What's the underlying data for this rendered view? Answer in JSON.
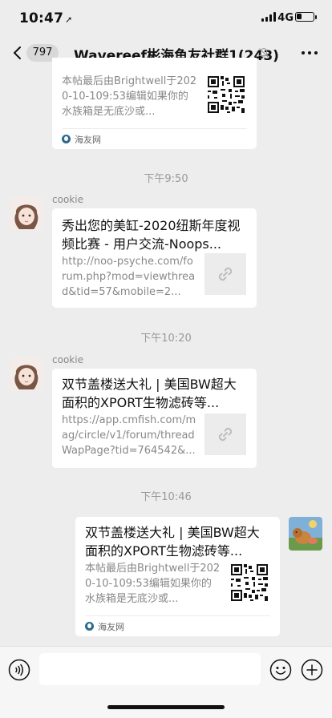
{
  "status": {
    "time": "10:47",
    "network": "4G"
  },
  "nav": {
    "unread_count": "797",
    "title": "Wavereef彬海鱼友社群1(243)"
  },
  "messages": [
    {
      "desc": "本帖最后由Brightwell于2020-10-109:53编辑如果你的水族箱是无底沙或...",
      "source": "海友网"
    },
    {
      "timestamp": "下午9:50"
    },
    {
      "sender": "cookie",
      "title": "秀出您的美缸-2020纽斯年度视频比赛 - 用户交流-Noops...",
      "desc": "http://noo-psyche.com/forum.php?mod=viewthread&tid=57&mobile=2..."
    },
    {
      "timestamp": "下午10:20"
    },
    {
      "sender": "cookie",
      "title": "双节盖楼送大礼 | 美国BW超大面积的XPORT生物滤砖等...",
      "desc": "https://app.cmfish.com/mag/circle/v1/forum/threadWapPage?tid=764542&..."
    },
    {
      "timestamp": "下午10:46"
    },
    {
      "title": "双节盖楼送大礼 | 美国BW超大面积的XPORT生物滤砖等...",
      "desc": "本帖最后由Brightwell于2020-10-109:53编辑如果你的水族箱是无底沙或...",
      "source": "海友网"
    }
  ]
}
